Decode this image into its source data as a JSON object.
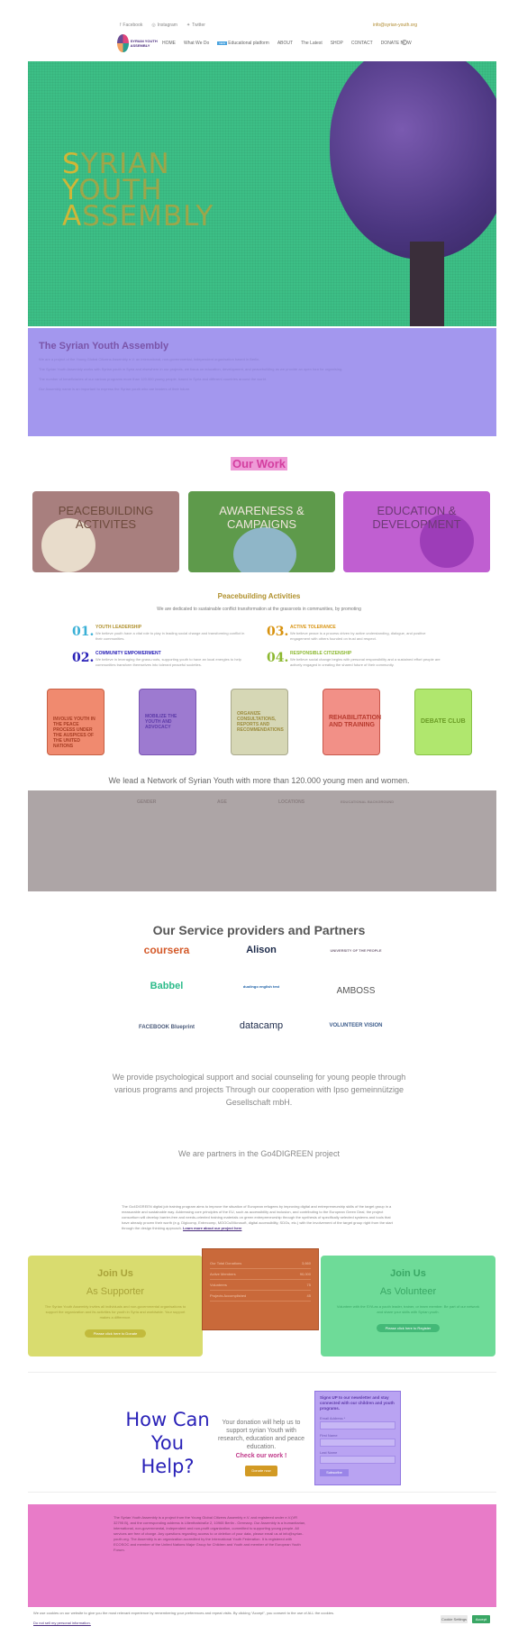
{
  "topbar": {
    "social": [
      "Facebook",
      "Instagram",
      "Twitter"
    ],
    "email": "info@syrian-youth.org"
  },
  "nav": {
    "logo_text": "SYRIAN YOUTH ASSEMBLY",
    "items": [
      "HOME",
      "What We Do",
      "Educational platform",
      "ABOUT",
      "The Latest",
      "SHOP",
      "CONTACT",
      "DONATE NOW"
    ],
    "new_badge": "NEW"
  },
  "hero": {
    "line1_initial": "S",
    "line1_rest": "YRIAN",
    "line2_initial": "Y",
    "line2_rest": "OUTH",
    "line3_initial": "A",
    "line3_rest": "SSEMBLY"
  },
  "about": {
    "title": "The Syrian Youth Assembly",
    "paragraphs": [
      "We are a project of the Young Global Citizens Assembly e.V. an international, non-governmental, independent organisation based in Berlin.",
      "The Syrian Youth Assembly works with Syrian youth in Syria and elsewhere in our projects, we focus on education, development, and peacebuilding as we provide an open fora for organising.",
      "The number of beneficiaries of our various programs more than 120.000 young people, based in Syria and different countries around the world.",
      "Our Assembly name is an important to express the Syrian youth who are leaders of their future."
    ]
  },
  "our_work": {
    "title": "Our Work",
    "cards": [
      "PEACEBUILDING ACTIVITES",
      "AWARENESS & CAMPAIGNS",
      "EDUCATION & DEVELOPMENT"
    ]
  },
  "peacebuilding": {
    "title": "Peacebuilding Activities",
    "subtitle": "We are dedicated to sustainable conflict transformation at the grassroots in communities, by promoting",
    "items": [
      {
        "num": "01.",
        "head": "YOUTH LEADERSHIP",
        "desc": "We believe youth have a vital role to play in leading social change and transforming conflict in their communities."
      },
      {
        "num": "03.",
        "head": "ACTIVE TOLERANCE",
        "desc": "We believe peace is a process driven by active understanding, dialogue, and positive engagement with others founded on trust and respect."
      },
      {
        "num": "02.",
        "head": "COMMUNITY EMPOWERMENT",
        "desc": "We believe in leveraging the grass-roots, supporting youth to have an local energies to help communities transform themselves into tolerant peaceful societies."
      },
      {
        "num": "04.",
        "head": "RESPONSIBLE CITIZENSHIP",
        "desc": "We believe social change begins with personal responsibility and a sustained effort people are actively engaged in creating the shared future of their community."
      }
    ],
    "tiles": [
      "INVOLVE YOUTH IN THE PEACE PROCESS UNDER THE AUSPICES OF THE UNITED NATIONS",
      "MOBILIZE THE YOUTH AND ADVOCACY",
      "ORGANIZE CONSULTATIONS, REPORTS AND RECOMMENDATIONS",
      "REHABILITATION AND TRAINING",
      "DEBATE CLUB"
    ]
  },
  "network": {
    "text": "We lead a Network of Syrian Youth with more than 120.000 young men and women.",
    "headers": [
      "GENDER",
      "AGE",
      "LOCATIONS",
      "EDUCATIONAL BACKGROUND"
    ]
  },
  "partners": {
    "title": "Our Service providers and Partners",
    "logos": [
      "coursera",
      "Alison",
      "UNIVERSITY OF THE PEOPLE",
      "Babbel",
      "duolingo english test",
      "AMBOSS",
      "FACEBOOK Blueprint",
      "datacamp",
      "VOLUNTEER VISION"
    ],
    "provide_text": "We provide psychological support and social counseling for young people through various programs and projects Through our cooperation with Ipso gemeinnützige Gesellschaft mbH.",
    "go4_title": "We are partners in the Go4DIGREEN project",
    "go4_text": "The Go4DIGREEN digital job training program aims to improve the situation of European refugees by improving digital and entrepreneurship skills of the target group in a measurable and sustainable way. Addressing core principles of the EU, such as accessibility and inclusion, and contributing to the European Green Deal, the project consortium will develop barrier-free and needs-oriented training materials on green entrepreneurship through the synthesis of specifically selected systems and tools that have already proven their worth (e.g. Digicomp, Entrecomp, MOOCs/Microsoft, digital accessibility, SDGs, etc.) with the involvement of the target group right from the start through the design thinking approach.",
    "go4_link": "Learn more about our project here"
  },
  "join": {
    "supporter": {
      "title": "Join Us",
      "sub": "As Supporter",
      "desc": "The Syrian Youth Assembly invites all individuals and non-governmental organisations to support the organization and its activities for youth in Syria and worldwide. Your support makes a difference.",
      "button": "Please click here to Donate"
    },
    "volunteer": {
      "title": "Join Us",
      "sub": "As Volunteer",
      "desc": "Volunteer with the SYA as a youth leader, trainer, or team member. Be part of our network and share your skills with Syrian youth.",
      "button": "Please click here to Register"
    },
    "stats_rows": [
      {
        "label": "Our Total Donations",
        "value": "3,660"
      },
      {
        "label": "Active Members",
        "value": "90,000"
      },
      {
        "label": "Volunteers",
        "value": "75"
      },
      {
        "label": "Projects Accomplished",
        "value": "45"
      }
    ]
  },
  "donate": {
    "how_line1": "How Can",
    "how_line2": "You",
    "how_line3": "Help?",
    "text": "Your donation will help us to support syrian Youth with research, education and peace education.",
    "check": "Check our work !",
    "button": "Donate now"
  },
  "newsletter": {
    "head": "Signs UP to our newsletter and stay connected with our children and youth programs.",
    "email_label": "Email Address *",
    "first_label": "First Name",
    "last_label": "Last Name",
    "submit": "Subscribe"
  },
  "footer": {
    "text": "The Syrian Youth Assembly is a project from the Young Global Citizens Assembly e.V. and registered under e.V.(VR 32795 B), and the corresponding address is Lilienthalstraße 2, 10965 Berlin - Germany. Our Assembly is a humanitarian, international, non-governmental, independent and non-profit organization, committed to supporting young people. All services are free of charge. Any questions regarding access to or deletion of your data, please email us at info@syrian-youth.org. The Assembly is an organization accredited by the International Youth Federation. It is registered with ECOSOC and member of the United Nations Major Group for Children and Youth and member of the European Youth Forum."
  },
  "cookie": {
    "text": "We use cookies on our website to give you the most relevant experience by remembering your preferences and repeat visits. By clicking “Accept”, you consent to the use of ALL the cookies.",
    "link": "Do not sell my personal information.",
    "settings": "Cookie Settings",
    "accept": "Accept"
  }
}
